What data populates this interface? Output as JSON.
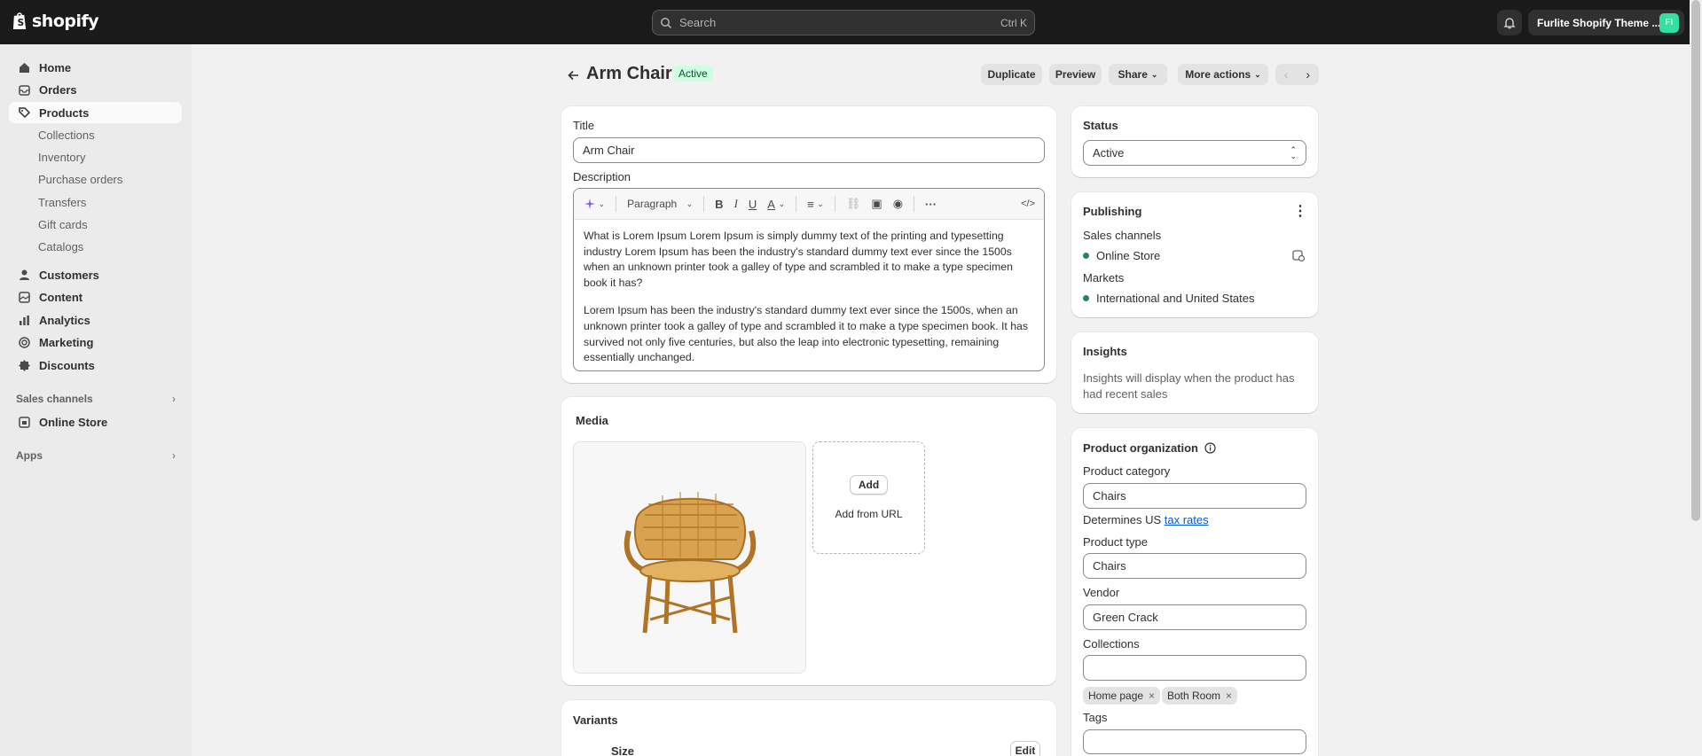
{
  "topbar": {
    "logo_text": "shopify",
    "search_placeholder": "Search",
    "search_shortcut": "Ctrl K",
    "store_name": "Furlite Shopify Theme ...",
    "store_avatar": "FI"
  },
  "sidebar": {
    "items": [
      {
        "label": "Home",
        "icon": "home-icon"
      },
      {
        "label": "Orders",
        "icon": "inbox-icon"
      },
      {
        "label": "Products",
        "icon": "tag-icon"
      },
      {
        "label": "Customers",
        "icon": "person-icon"
      },
      {
        "label": "Content",
        "icon": "content-icon"
      },
      {
        "label": "Analytics",
        "icon": "bar-chart-icon"
      },
      {
        "label": "Marketing",
        "icon": "target-icon"
      },
      {
        "label": "Discounts",
        "icon": "discount-icon"
      }
    ],
    "product_subitems": [
      "Collections",
      "Inventory",
      "Purchase orders",
      "Transfers",
      "Gift cards",
      "Catalogs"
    ],
    "sales_channels_heading": "Sales channels",
    "online_store": "Online Store",
    "apps_heading": "Apps"
  },
  "header": {
    "title": "Arm Chair",
    "status_badge": "Active",
    "buttons": {
      "duplicate": "Duplicate",
      "preview": "Preview",
      "share": "Share",
      "more_actions": "More actions"
    }
  },
  "product": {
    "title_label": "Title",
    "title_value": "Arm Chair",
    "description_label": "Description",
    "paragraph_select": "Paragraph",
    "description_paragraphs": [
      "What is Lorem Ipsum Lorem Ipsum is simply dummy text of the printing and typesetting industry Lorem Ipsum has been the industry's standard dummy text ever since the 1500s when an unknown printer took a galley of type and scrambled it to make a type specimen book it has?",
      "Lorem Ipsum has been the industry's standard dummy text ever since the 1500s, when an unknown printer took a galley of type and scrambled it to make a type specimen book. It has survived not only five centuries, but also the leap into electronic typesetting, remaining essentially unchanged."
    ]
  },
  "media": {
    "heading": "Media",
    "add_button": "Add",
    "add_from_url": "Add from URL"
  },
  "variants": {
    "heading": "Variants",
    "option_name": "Size",
    "edit_button": "Edit"
  },
  "status": {
    "heading": "Status",
    "value": "Active"
  },
  "publishing": {
    "heading": "Publishing",
    "sales_channels_label": "Sales channels",
    "channel": "Online Store",
    "markets_label": "Markets",
    "market": "International and United States"
  },
  "insights": {
    "heading": "Insights",
    "text": "Insights will display when the product has had recent sales"
  },
  "organization": {
    "heading": "Product organization",
    "category_label": "Product category",
    "category_value": "Chairs",
    "tax_prefix": "Determines US",
    "tax_link": "tax rates",
    "type_label": "Product type",
    "type_value": "Chairs",
    "vendor_label": "Vendor",
    "vendor_value": "Green Crack",
    "collections_label": "Collections",
    "collection_tags": [
      "Home page",
      "Both Room"
    ],
    "tags_label": "Tags"
  },
  "colors": {
    "topbar": "#1a1a1a",
    "badge_bg": "#cdfee1",
    "status_dot": "#29845a",
    "link": "#005bd3"
  }
}
